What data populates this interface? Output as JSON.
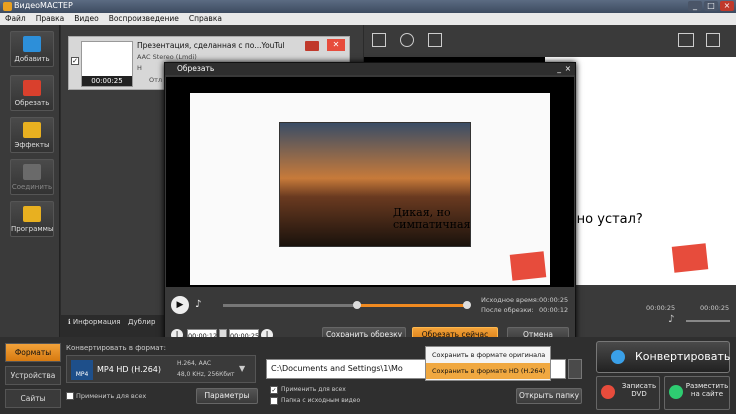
{
  "app": {
    "title": "ВидеоМАСТЕР"
  },
  "menu": [
    "Файл",
    "Правка",
    "Видео",
    "Воспроизведение",
    "Справка"
  ],
  "sidebar": [
    {
      "label": "Добавить",
      "icon": "add-video-icon",
      "color": "#2d8fd9"
    },
    {
      "label": "Обрезать",
      "icon": "scissors-icon",
      "color": "#d9402d"
    },
    {
      "label": "Эффекты",
      "icon": "effects-icon",
      "color": "#e8b020"
    },
    {
      "label": "Соединить",
      "icon": "join-icon",
      "color": "#7a7a7a"
    },
    {
      "label": "Программы",
      "icon": "programs-icon",
      "color": "#e8b020"
    }
  ],
  "file": {
    "title": "Презентация, сделанная с по...YouTul",
    "audio": "AAC Stereo (Lmdi)",
    "time": "00:00:25",
    "flags": [
      "Н",
      "Н",
      "Отл"
    ]
  },
  "tabs": {
    "info": "Информация",
    "dub": "Дублир"
  },
  "dialog": {
    "title": "Обрезать",
    "caption": "Дикая, но симпатичная",
    "source_duration_label": "Исходное время:",
    "source_duration": "00:00:25",
    "after_trim_label": "После обрезки:",
    "after_trim": "00:00:12",
    "start_time": "00:00:12",
    "end_time": "00:00:25",
    "save_trim": "Сохранить обрезку",
    "trim_now": "Обрезать сейчас",
    "cancel": "Отмена"
  },
  "dropdown": {
    "items": [
      "Сохранить в формате оригинала",
      "Сохранить в формате HD (H.264)"
    ]
  },
  "preview": {
    "subtitle": "ьно устал?",
    "time1": "00:00:25",
    "time2": "00:00:25"
  },
  "bottom": {
    "tabs": [
      "Форматы",
      "Устройства",
      "Сайты"
    ],
    "convert_to": "Конвертировать в формат:",
    "format_name": "MP4 HD (H.264)",
    "format_badge": "MP4",
    "codec1": "H.264, AAC",
    "codec2": "48,0 KHz, 256Кбит",
    "apply_all": "Применить для всех",
    "params": "Параметры",
    "path": "C:\\Documents and Settings\\1\\Мо",
    "apply_all2": "Применить для всех",
    "src_folder": "Папка с исходным видео",
    "open_folder": "Открыть папку",
    "convert": "Конвертировать",
    "burn_dvd": "Записать DVD",
    "publish": "Разместить на сайте"
  }
}
